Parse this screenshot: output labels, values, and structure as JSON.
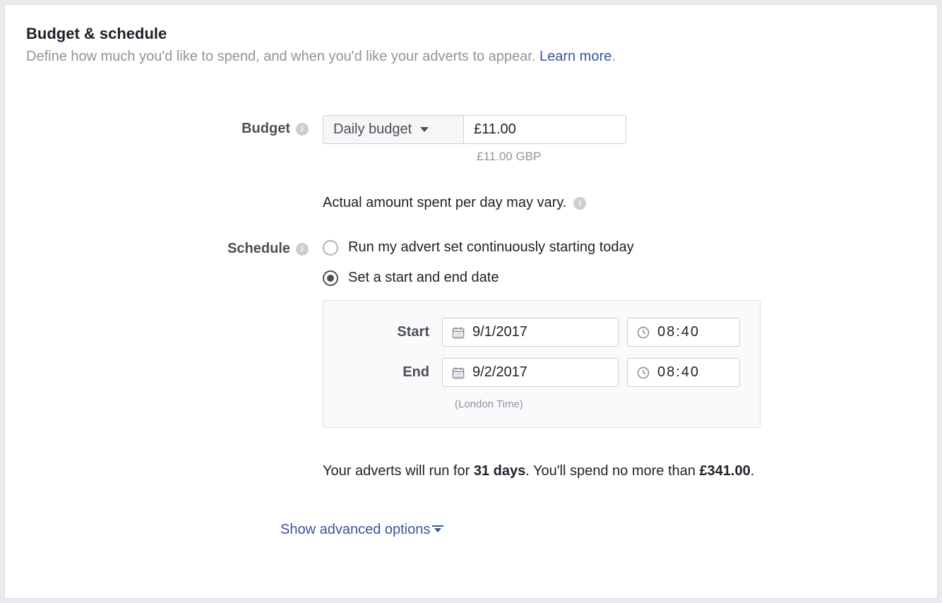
{
  "header": {
    "title": "Budget & schedule",
    "description": "Define how much you'd like to spend, and when you'd like your adverts to appear. ",
    "learn_more": "Learn more"
  },
  "budget": {
    "label": "Budget",
    "dropdown_label": "Daily budget",
    "amount": "£11.00",
    "amount_hint": "£11.00 GBP",
    "vary_note": "Actual amount spent per day may vary."
  },
  "schedule": {
    "label": "Schedule",
    "option_continuous": "Run my advert set continuously starting today",
    "option_dates": "Set a start and end date",
    "selected": "dates",
    "start_label": "Start",
    "end_label": "End",
    "start_date": "9/1/2017",
    "start_time": "08:40",
    "end_date": "9/2/2017",
    "end_time": "08:40",
    "timezone_note": "(London Time)"
  },
  "summary": {
    "prefix": "Your adverts will run for ",
    "days": "31 days",
    "middle": ". You'll spend no more than ",
    "total": "£341.00",
    "suffix": "."
  },
  "advanced": {
    "label": "Show advanced options"
  }
}
